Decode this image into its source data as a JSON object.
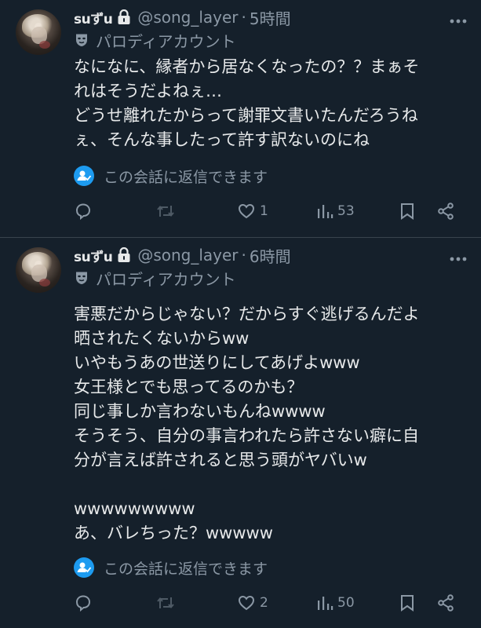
{
  "colors": {
    "background": "#15202b",
    "text_primary": "#e7e9ea",
    "text_secondary": "#8b98a5",
    "accent_blue": "#1d9bf0",
    "divider": "#38444d"
  },
  "tweets": [
    {
      "author": {
        "display_name": "suずu",
        "handle": "@song_layer",
        "separator": "·",
        "time": "5時間",
        "parody_label": "パロディアカウント",
        "locked_icon": "lock-icon",
        "parody_icon": "mask-icon"
      },
      "body_lines": [
        "なになに、縁者から居なくなったの？？まぁそ",
        "れはそうだよねぇ…",
        "どうせ離れたからって謝罪文書いたんだろうね",
        "ぇ、そんな事したって許す訳ないのにね"
      ],
      "reply_notice": "この会話に返信できます",
      "actions": {
        "reply_icon": "reply-icon",
        "retweet_icon": "retweet-icon",
        "like_icon": "heart-icon",
        "like_count": "1",
        "views_icon": "views-icon",
        "views_count": "53",
        "bookmark_icon": "bookmark-icon",
        "share_icon": "share-icon"
      }
    },
    {
      "author": {
        "display_name": "suずu",
        "handle": "@song_layer",
        "separator": "·",
        "time": "6時間",
        "parody_label": "パロディアカウント",
        "locked_icon": "lock-icon",
        "parody_icon": "mask-icon"
      },
      "body_lines": [
        "害悪だからじゃない？だからすぐ逃げるんだよ",
        "晒されたくないからww",
        "いやもうあの世送りにしてあげよwww",
        "女王様とでも思ってるのかも？",
        "同じ事しか言わないもんねwwww",
        "そうそう、自分の事言われたら許さない癖に自",
        "分が言えば許されると思う頭がヤバいw",
        "",
        "wwwwwwwww",
        "あ、バレちった？wwwww"
      ],
      "reply_notice": "この会話に返信できます",
      "actions": {
        "reply_icon": "reply-icon",
        "retweet_icon": "retweet-icon",
        "like_icon": "heart-icon",
        "like_count": "2",
        "views_icon": "views-icon",
        "views_count": "50",
        "bookmark_icon": "bookmark-icon",
        "share_icon": "share-icon"
      }
    }
  ]
}
